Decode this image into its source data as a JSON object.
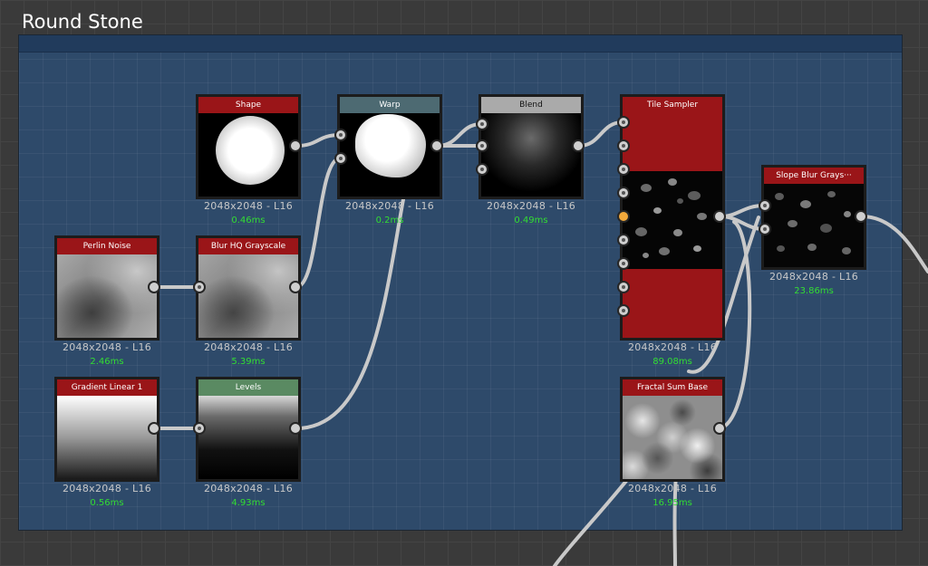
{
  "graph": {
    "frame_title": "Round Stone"
  },
  "colors": {
    "header_red": "#9a1518",
    "header_teal": "#4d6a72",
    "header_gray": "#aaaaaa",
    "header_green": "#5a8a62",
    "time_green": "#33dd33",
    "active_port": "#f2a93b"
  },
  "nodes": {
    "shape": {
      "title": "Shape",
      "res": "2048x2048 - L16",
      "time": "0.46ms"
    },
    "warp": {
      "title": "Warp",
      "res": "2048x2048 - L16",
      "time": "0.2ms"
    },
    "blend": {
      "title": "Blend",
      "res": "2048x2048 - L16",
      "time": "0.49ms"
    },
    "tile_sampler": {
      "title": "Tile Sampler",
      "res": "2048x2048 - L16",
      "time": "89.08ms"
    },
    "slope_blur": {
      "title": "Slope Blur Grays···",
      "res": "2048x2048 - L16",
      "time": "23.86ms"
    },
    "perlin_noise": {
      "title": "Perlin Noise",
      "res": "2048x2048 - L16",
      "time": "2.46ms"
    },
    "blur_hq": {
      "title": "Blur HQ Grayscale",
      "res": "2048x2048 - L16",
      "time": "5.39ms"
    },
    "gradient_linear": {
      "title": "Gradient Linear 1",
      "res": "2048x2048 - L16",
      "time": "0.56ms"
    },
    "levels": {
      "title": "Levels",
      "res": "2048x2048 - L16",
      "time": "4.93ms"
    },
    "fractal_sum": {
      "title": "Fractal Sum Base",
      "res": "2048x2048 - L16",
      "time": "16.95ms"
    }
  }
}
